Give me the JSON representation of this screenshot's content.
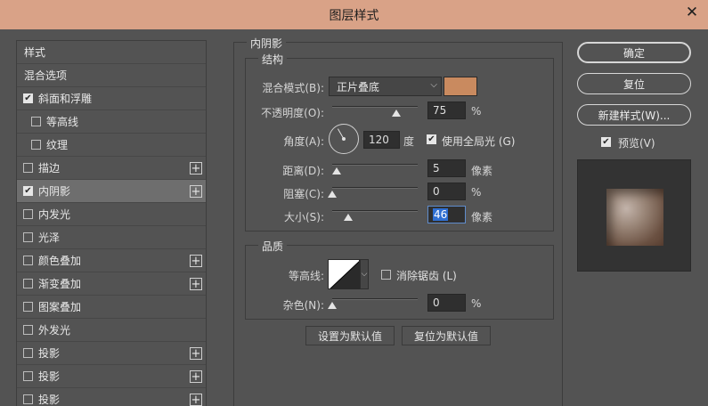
{
  "window": {
    "title": "图层样式",
    "close_glyph": "✕"
  },
  "styles_list": [
    {
      "label": "样式",
      "checkbox": false,
      "checked": false,
      "plus": false,
      "selected": false,
      "indent": 0
    },
    {
      "label": "混合选项",
      "checkbox": false,
      "checked": false,
      "plus": false,
      "selected": false,
      "indent": 0
    },
    {
      "label": "斜面和浮雕",
      "checkbox": true,
      "checked": true,
      "plus": false,
      "selected": false,
      "indent": 0
    },
    {
      "label": "等高线",
      "checkbox": true,
      "checked": false,
      "plus": false,
      "selected": false,
      "indent": 1
    },
    {
      "label": "纹理",
      "checkbox": true,
      "checked": false,
      "plus": false,
      "selected": false,
      "indent": 1
    },
    {
      "label": "描边",
      "checkbox": true,
      "checked": false,
      "plus": true,
      "selected": false,
      "indent": 0
    },
    {
      "label": "内阴影",
      "checkbox": true,
      "checked": true,
      "plus": true,
      "selected": true,
      "indent": 0
    },
    {
      "label": "内发光",
      "checkbox": true,
      "checked": false,
      "plus": false,
      "selected": false,
      "indent": 0
    },
    {
      "label": "光泽",
      "checkbox": true,
      "checked": false,
      "plus": false,
      "selected": false,
      "indent": 0
    },
    {
      "label": "颜色叠加",
      "checkbox": true,
      "checked": false,
      "plus": true,
      "selected": false,
      "indent": 0
    },
    {
      "label": "渐变叠加",
      "checkbox": true,
      "checked": false,
      "plus": true,
      "selected": false,
      "indent": 0
    },
    {
      "label": "图案叠加",
      "checkbox": true,
      "checked": false,
      "plus": false,
      "selected": false,
      "indent": 0
    },
    {
      "label": "外发光",
      "checkbox": true,
      "checked": false,
      "plus": false,
      "selected": false,
      "indent": 0
    },
    {
      "label": "投影",
      "checkbox": true,
      "checked": false,
      "plus": true,
      "selected": false,
      "indent": 0
    },
    {
      "label": "投影",
      "checkbox": true,
      "checked": false,
      "plus": true,
      "selected": false,
      "indent": 0
    },
    {
      "label": "投影",
      "checkbox": true,
      "checked": false,
      "plus": true,
      "selected": false,
      "indent": 0
    }
  ],
  "inner_shadow": {
    "section_title": "内阴影",
    "structure": {
      "title": "结构",
      "blend_mode_label": "混合模式(B):",
      "blend_mode_value": "正片叠底",
      "blend_color": "#c98a5f",
      "opacity_label": "不透明度(O):",
      "opacity_value": "75",
      "opacity_unit": "%",
      "opacity_level": 0.75,
      "angle_label": "角度(A):",
      "angle_value": "120",
      "angle_unit": "度",
      "global_light_label": "使用全局光 (G)",
      "global_light_checked": true,
      "distance_label": "距离(D):",
      "distance_value": "5",
      "distance_unit": "像素",
      "distance_level": 0.05,
      "choke_label": "阻塞(C):",
      "choke_value": "0",
      "choke_unit": "%",
      "choke_level": 0.0,
      "size_label": "大小(S):",
      "size_value": "46",
      "size_unit": "像素",
      "size_level": 0.19
    },
    "quality": {
      "title": "品质",
      "contour_label": "等高线:",
      "antialias_label": "消除锯齿 (L)",
      "antialias_checked": false,
      "noise_label": "杂色(N):",
      "noise_value": "0",
      "noise_unit": "%",
      "noise_level": 0.0
    },
    "make_default_label": "设置为默认值",
    "reset_default_label": "复位为默认值"
  },
  "actions": {
    "ok_label": "确定",
    "reset_label": "复位",
    "new_style_label": "新建样式(W)...",
    "preview_label": "预览(V)",
    "preview_checked": true
  }
}
